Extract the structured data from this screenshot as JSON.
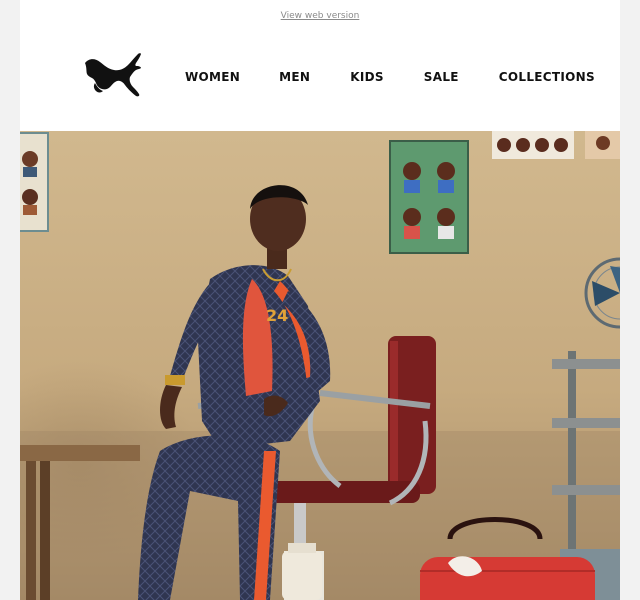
{
  "preheader": {
    "view_web_label": "View web version"
  },
  "brand": {
    "logo_name": "puma-logo",
    "logo_color": "#111111"
  },
  "nav": {
    "items": [
      {
        "label": "WOMEN"
      },
      {
        "label": "MEN"
      },
      {
        "label": "KIDS"
      },
      {
        "label": "SALE"
      },
      {
        "label": "COLLECTIONS"
      }
    ]
  },
  "hero": {
    "description_hidden": "",
    "colors": {
      "wall": "#c9ae84",
      "wall_dark": "#9b7d58",
      "floor": "#7b6a55",
      "tracksuit": "#2f3550",
      "stripe": "#ea5a2f",
      "chair": "#7a1f1f",
      "bag": "#d63a34"
    }
  }
}
